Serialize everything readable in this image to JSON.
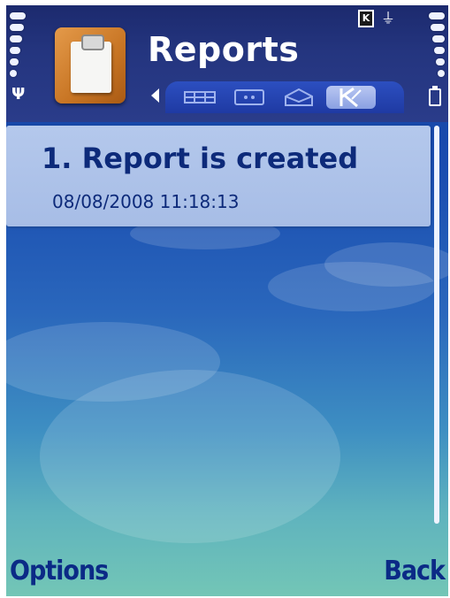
{
  "header": {
    "title": "Reports",
    "app_icon": "clipboard-report-icon",
    "status_indicator": "K",
    "connection_glyph": "⏚"
  },
  "tabs": [
    {
      "icon": "grid-icon",
      "active": false
    },
    {
      "icon": "dots-icon",
      "active": false
    },
    {
      "icon": "envelope-icon",
      "active": false
    },
    {
      "icon": "k-logo-icon",
      "active": true
    }
  ],
  "reports": [
    {
      "title": "1. Report is created",
      "date": "08/08/2008 11:18:13"
    }
  ],
  "softkeys": {
    "left": "Options",
    "right": "Back"
  },
  "colors": {
    "text_dark_blue": "#0d2a7a",
    "softkey_blue": "#0b2a86",
    "header_navy": "#24357f",
    "list_highlight": "#b4c8ec"
  }
}
